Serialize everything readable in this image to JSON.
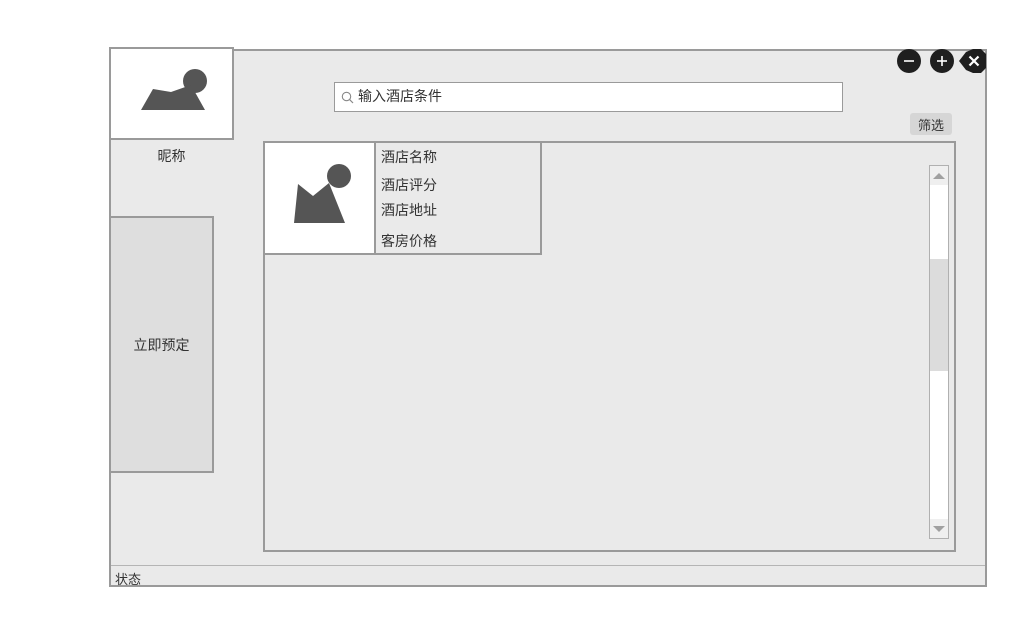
{
  "window_controls": {
    "minimize_icon": "minus-circle",
    "maximize_icon": "plus-circle",
    "close_icon": "close"
  },
  "sidebar": {
    "avatar_icon": "image-placeholder",
    "nickname": "昵称",
    "book_button": "立即预定"
  },
  "search": {
    "placeholder": "输入酒店条件",
    "value": "",
    "icon": "search-icon"
  },
  "filter_button": "筛选",
  "hotel_card": {
    "image_icon": "image-placeholder",
    "name": "酒店名称",
    "rating": "酒店评分",
    "address": "酒店地址",
    "price": "客房价格"
  },
  "status_bar": {
    "text": "状态"
  },
  "colors": {
    "window_bg": "#eaeaea",
    "border": "#9a9a9a",
    "icon_dark": "#555555",
    "control_dark": "#1f1f1f"
  }
}
